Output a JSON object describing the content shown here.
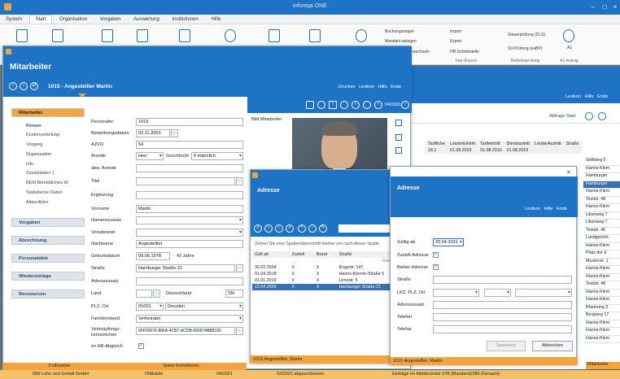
{
  "app": {
    "title": "infoniqa ONE"
  },
  "menu": [
    "System",
    "Start",
    "Organisation",
    "Vorgaben",
    "Auswertung",
    "Institutionen",
    "Hilfe"
  ],
  "ribbon": {
    "groups": [
      {
        "label": "Buchungsstapel"
      },
      {
        "label": "Mandant anlegen"
      },
      {
        "label": "wechseln"
      },
      {
        "label": "Import"
      },
      {
        "label": "Export"
      },
      {
        "label": "HR-Schnittstelle"
      },
      {
        "label": "Steuerprüfung (DLS)"
      },
      {
        "label": "SV-Prüfung (euBP)"
      },
      {
        "label": "A1"
      }
    ],
    "section_labels": [
      "Imp-/Export",
      "Betriebsprüfung",
      "A1-Antrag"
    ]
  },
  "bg": {
    "toolbar": [
      "Lexikon",
      "Hilfe",
      "Ende"
    ],
    "abfrage": "Abfrage Start",
    "cols": [
      "Tarifliche",
      "LetzterEintritt",
      "Tarifeintritt",
      "Dienstantritt",
      "LetzterAustritt",
      "Straße"
    ],
    "row": [
      "18.1",
      "01.08.2019",
      "01.08.2019",
      "01.08.2019"
    ],
    "streets": [
      "Gellberg 5",
      "Hanns-Klem",
      "Hamburger",
      "Hamburger",
      "Hanns-Klem",
      "Teststr. 48",
      "Hanns-Klem",
      "Lilienweg 7",
      "Lilienweg 7",
      "Teststr. 46",
      "Landgericht",
      "Hanns-Klem",
      "Platz der d",
      "Musterstr. 1",
      "Hanns-Klem",
      "Hanns-Klem",
      "Teststr. 48",
      "Hanns-Klem",
      "Hanns-Klem",
      "Rheinring 3",
      "Bergweg 17",
      "Hanns-Klem",
      "Hanns-Klem",
      "Hanns-Klem"
    ],
    "footer": "Mitarbeiter"
  },
  "ma": {
    "title": "Mitarbeiter",
    "header": "1015 - Angestellter Martin",
    "toolbar": [
      "Drucken",
      "Lexikon",
      "Hilfe",
      "Ende"
    ],
    "period": "04/2021",
    "photo_label": "Bild Mitarbeiter",
    "nav_sections": [
      {
        "label": "Mitarbeiter"
      },
      {
        "label": "Vorgaben"
      },
      {
        "label": "Abrechnung"
      },
      {
        "label": "Personalakte"
      },
      {
        "label": "Wiedervorlage"
      },
      {
        "label": "Ressourcen"
      }
    ],
    "nav_items": [
      "Person",
      "Kostenverteilung",
      "Vorgang",
      "Organisation",
      "Info",
      "Zusatzdaten 1",
      "BEM Betriebliches W",
      "Statistische Daten",
      "Akkordlohn"
    ],
    "fields": [
      {
        "label": "Personalnr.",
        "value": "1015"
      },
      {
        "label": "Bewerbungsdatum",
        "value": "02.11.2003"
      },
      {
        "label": "AZVO",
        "value": "54"
      },
      {
        "label": "Anrede",
        "value": "Herr"
      },
      {
        "label": "abw. Anrede",
        "value": ""
      },
      {
        "label": "Titel",
        "value": ""
      },
      {
        "label": "Ergänzung",
        "value": ""
      },
      {
        "label": "Vorname",
        "value": "Martin"
      },
      {
        "label": "Namenszusatz",
        "value": ""
      },
      {
        "label": "Vorsatzwort",
        "value": ""
      },
      {
        "label": "Nachname",
        "value": "Angestellter"
      },
      {
        "label": "Geburtsdatum",
        "value": "09.06.1978"
      },
      {
        "label": "Straße",
        "value": "Hamburger Straße 21"
      },
      {
        "label": "Adresszusatz",
        "value": ""
      },
      {
        "label": "Land",
        "value": ""
      },
      {
        "label": "PLZ, Ort",
        "value": "01001"
      },
      {
        "label": "Familienstand",
        "value": "Verheiratet"
      },
      {
        "label": "Verknüpfungs-kennzeichen",
        "value": "6FF03076-86FA-4CB7-ACDB-506874B8B156"
      },
      {
        "label": "im HR-Abgleich",
        "value": ""
      }
    ],
    "geschlecht_label": "Geschlecht",
    "geschlecht": "0 männlich",
    "age": "42 Jahre",
    "land_name": "Deutschland",
    "land_code": "SN",
    "ort": "Dresden",
    "status": [
      "3 Hinweise",
      "keine Korrekturen"
    ]
  },
  "ad1": {
    "title": "Adresse",
    "hint": "Ziehen Sie eine Spaltenüberschrift hierher um nach dieser Spalte",
    "filter": "Hier anklick",
    "cols": [
      "Gült ab",
      "Zustell",
      "Bezer",
      "Straße"
    ],
    "rows": [
      [
        "30.03.2004",
        "X",
        "X",
        "Engestr. 147"
      ],
      [
        "01.04.2018",
        "X",
        "X",
        "Hanns-Klemm-Straße 5"
      ],
      [
        "01.01.2019",
        "X",
        "X",
        "Lenzstr. 5"
      ],
      [
        "15.04.2020",
        "X",
        "X",
        "Hamburger Straße 21"
      ]
    ],
    "footer": "1015 Angestellter, Martin"
  },
  "ad2": {
    "title": "Adresse",
    "toolbar": [
      "Lexikon",
      "Hilfe",
      "Ende"
    ],
    "labels": [
      "Gültig ab",
      "Zustell-Adresse",
      "Bisher-Adresse",
      "Straße",
      "LKZ, PLZ, Ort",
      "Adresszusatz",
      "Telefon",
      "Telefax"
    ],
    "gueltig": "20.04.2021",
    "save": "Speichern",
    "cancel": "Abbrechen",
    "footer": "1015 Angestellter, Martin"
  },
  "statusbar": {
    "company": "999 Lohn und Gehalt GmbH",
    "user": "ONEdole",
    "period": "04/2021",
    "closed": "03/2021 abgeschlossen",
    "entries": "Einträge im Meldecenter 378 (Mandant)/380 (Gesamt)"
  }
}
